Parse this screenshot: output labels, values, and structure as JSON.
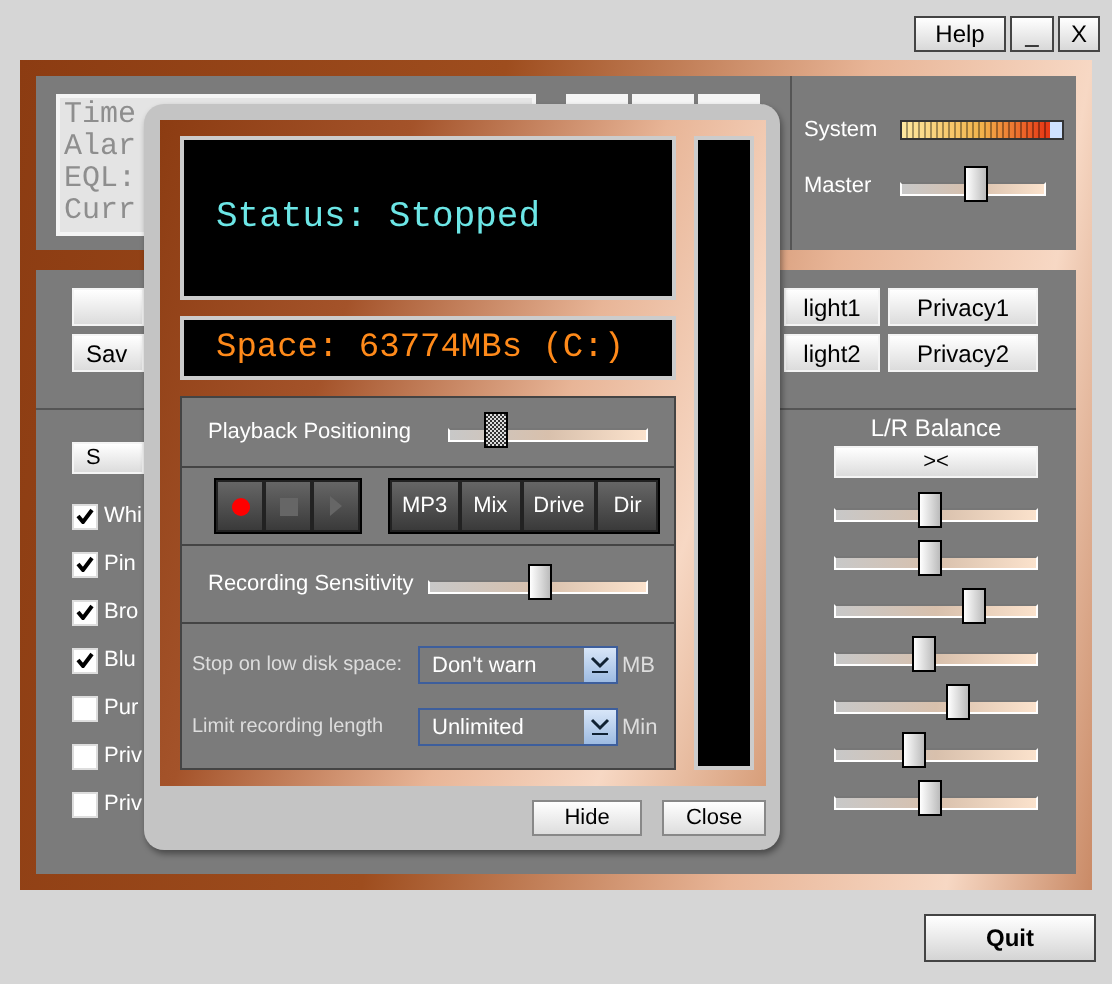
{
  "title_buttons": [
    "Help",
    "_",
    "X"
  ],
  "display": {
    "lines": [
      "Time",
      "Alar",
      "EQL:",
      "Curr"
    ]
  },
  "system_meter": {
    "label": "System",
    "level": 1
  },
  "master": {
    "label": "Master",
    "level": 0.52
  },
  "save_button": "Sav",
  "preset_buttons": [
    "light1",
    "Privacy1",
    "light2",
    "Privacy2"
  ],
  "left_button": "S",
  "checkboxes": [
    {
      "label": "Whi",
      "checked": true
    },
    {
      "label": "Pin",
      "checked": true
    },
    {
      "label": "Bro",
      "checked": true
    },
    {
      "label": "Blu",
      "checked": true
    },
    {
      "label": "Pur",
      "checked": false
    },
    {
      "label": "Priv",
      "checked": false
    },
    {
      "label": "Priv",
      "checked": false
    }
  ],
  "balance": {
    "label": "L/R Balance",
    "button": "><"
  },
  "eq_sliders": [
    {
      "level": 0.47
    },
    {
      "level": 0.47
    },
    {
      "level": 0.71
    },
    {
      "level": 0.43
    },
    {
      "level": 0.62
    },
    {
      "level": 0.38
    },
    {
      "level": 0.47
    }
  ],
  "quit_button": "Quit",
  "dialog": {
    "status": "Status: Stopped",
    "space": "Space: 63774MBs (C:)",
    "playback": {
      "label": "Playback Positioning",
      "level": 0.2
    },
    "transport": [
      {
        "kind": "record",
        "disabled": false
      },
      {
        "kind": "stop",
        "disabled": true
      },
      {
        "kind": "play",
        "disabled": true
      }
    ],
    "mode_buttons": [
      "MP3",
      "Mix",
      "Drive",
      "Dir"
    ],
    "sensitivity": {
      "label": "Recording Sensitivity",
      "level": 0.51
    },
    "settings": [
      {
        "label": "Stop on low disk space:",
        "value": "Don't warn",
        "unit": "MB"
      },
      {
        "label": "Limit recording length",
        "value": "Unlimited",
        "unit": "Min"
      }
    ],
    "buttons": [
      "Hide",
      "Close"
    ]
  }
}
